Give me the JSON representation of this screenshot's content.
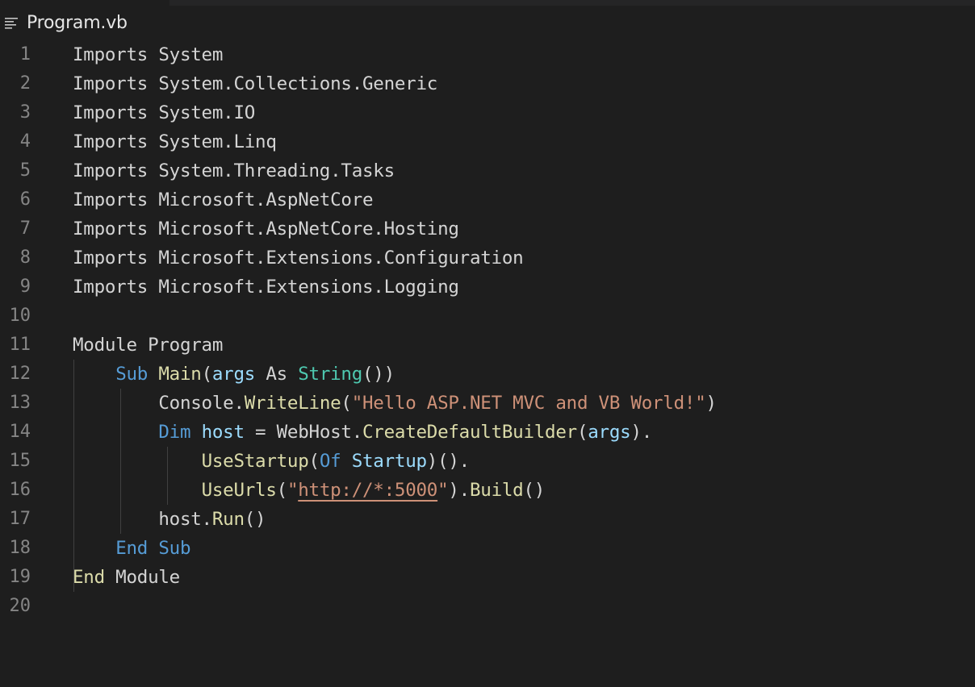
{
  "tab": {
    "file_name": "Program.vb",
    "icon": "lines-icon"
  },
  "colors": {
    "background": "#1e1e1e",
    "keyword": "#569cd6",
    "type": "#4ec9b0",
    "function": "#dcdcaa",
    "parameter": "#9cdcfe",
    "string": "#ce9178",
    "plain": "#d4d4d4",
    "line_number": "#858585"
  },
  "lines": [
    {
      "n": "1",
      "tokens": [
        {
          "t": "Imports System",
          "c": "plain"
        }
      ]
    },
    {
      "n": "2",
      "tokens": [
        {
          "t": "Imports System.Collections.Generic",
          "c": "plain"
        }
      ]
    },
    {
      "n": "3",
      "tokens": [
        {
          "t": "Imports System.IO",
          "c": "plain"
        }
      ]
    },
    {
      "n": "4",
      "tokens": [
        {
          "t": "Imports System.Linq",
          "c": "plain"
        }
      ]
    },
    {
      "n": "5",
      "tokens": [
        {
          "t": "Imports System.Threading.Tasks",
          "c": "plain"
        }
      ]
    },
    {
      "n": "6",
      "tokens": [
        {
          "t": "Imports Microsoft.AspNetCore",
          "c": "plain"
        }
      ]
    },
    {
      "n": "7",
      "tokens": [
        {
          "t": "Imports Microsoft.AspNetCore.Hosting",
          "c": "plain"
        }
      ]
    },
    {
      "n": "8",
      "tokens": [
        {
          "t": "Imports Microsoft.Extensions.Configuration",
          "c": "plain"
        }
      ]
    },
    {
      "n": "9",
      "tokens": [
        {
          "t": "Imports Microsoft.Extensions.Logging",
          "c": "plain"
        }
      ]
    },
    {
      "n": "10",
      "tokens": []
    },
    {
      "n": "11",
      "tokens": [
        {
          "t": "Module Program",
          "c": "plain"
        }
      ]
    },
    {
      "n": "12",
      "tokens": [
        {
          "t": "    ",
          "c": "plain"
        },
        {
          "t": "Sub",
          "c": "kw"
        },
        {
          "t": " ",
          "c": "plain"
        },
        {
          "t": "Main",
          "c": "fn"
        },
        {
          "t": "(",
          "c": "plain"
        },
        {
          "t": "args",
          "c": "param"
        },
        {
          "t": " As ",
          "c": "plain"
        },
        {
          "t": "String",
          "c": "type"
        },
        {
          "t": "())",
          "c": "plain"
        }
      ]
    },
    {
      "n": "13",
      "tokens": [
        {
          "t": "        Console.",
          "c": "plain"
        },
        {
          "t": "WriteLine",
          "c": "fn"
        },
        {
          "t": "(",
          "c": "plain"
        },
        {
          "t": "\"Hello ASP.NET MVC and VB World!\"",
          "c": "str"
        },
        {
          "t": ")",
          "c": "plain"
        }
      ]
    },
    {
      "n": "14",
      "tokens": [
        {
          "t": "        ",
          "c": "plain"
        },
        {
          "t": "Dim",
          "c": "kw"
        },
        {
          "t": " ",
          "c": "plain"
        },
        {
          "t": "host",
          "c": "param"
        },
        {
          "t": " = WebHost.",
          "c": "plain"
        },
        {
          "t": "CreateDefaultBuilder",
          "c": "fn"
        },
        {
          "t": "(",
          "c": "plain"
        },
        {
          "t": "args",
          "c": "param"
        },
        {
          "t": ").",
          "c": "plain"
        }
      ]
    },
    {
      "n": "15",
      "tokens": [
        {
          "t": "            ",
          "c": "plain"
        },
        {
          "t": "UseStartup",
          "c": "fn"
        },
        {
          "t": "(",
          "c": "plain"
        },
        {
          "t": "Of",
          "c": "kw"
        },
        {
          "t": " ",
          "c": "plain"
        },
        {
          "t": "Startup",
          "c": "param"
        },
        {
          "t": ")().",
          "c": "plain"
        }
      ]
    },
    {
      "n": "16",
      "tokens": [
        {
          "t": "            ",
          "c": "plain"
        },
        {
          "t": "UseUrls",
          "c": "fn"
        },
        {
          "t": "(",
          "c": "plain"
        },
        {
          "t": "\"",
          "c": "str"
        },
        {
          "t": "http://*:5000",
          "c": "url"
        },
        {
          "t": "\"",
          "c": "str"
        },
        {
          "t": ").",
          "c": "plain"
        },
        {
          "t": "Build",
          "c": "fn"
        },
        {
          "t": "()",
          "c": "plain"
        }
      ]
    },
    {
      "n": "17",
      "tokens": [
        {
          "t": "        host.",
          "c": "plain"
        },
        {
          "t": "Run",
          "c": "fn"
        },
        {
          "t": "()",
          "c": "plain"
        }
      ]
    },
    {
      "n": "18",
      "tokens": [
        {
          "t": "    ",
          "c": "plain"
        },
        {
          "t": "End Sub",
          "c": "kw"
        }
      ]
    },
    {
      "n": "19",
      "tokens": [
        {
          "t": "End",
          "c": "fn"
        },
        {
          "t": " Module",
          "c": "plain"
        }
      ]
    },
    {
      "n": "20",
      "tokens": []
    }
  ]
}
